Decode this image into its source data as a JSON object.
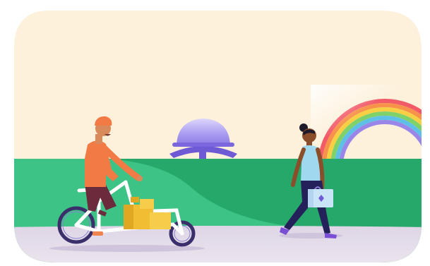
{
  "scene": {
    "colors": {
      "sky": "#fdf1dc",
      "hill": "#26a86a",
      "hill_highlight": "#3dc386",
      "ground": "#e8e0ea",
      "ground_shade": "#ddd3e4",
      "dome": "#a99af0",
      "dome_base": "#6f5ad6",
      "rider_shirt": "#f27b45",
      "rider_pants": "#6b2b3c",
      "rider_skin": "#d88a5a",
      "cargo": "#f1bd32",
      "bike_frame": "#ffffff",
      "wheel": "#3a2f6b",
      "walker_top": "#9fd8ef",
      "walker_pants": "#23205a",
      "walker_skin": "#8a4e2a",
      "bag": "#c9e3f7",
      "shoes": "#7a4fd6",
      "rainbow": [
        "#f25a68",
        "#f7924a",
        "#f6cf45",
        "#7fd16a",
        "#5ec0e7",
        "#9a86e8"
      ]
    },
    "elements": {
      "background": "rounded-card-background",
      "rider": "cargo-bike-rider",
      "walker": "woman-walking-with-bag",
      "dome": "dome-structure",
      "rainbow": "rainbow-arc"
    }
  }
}
